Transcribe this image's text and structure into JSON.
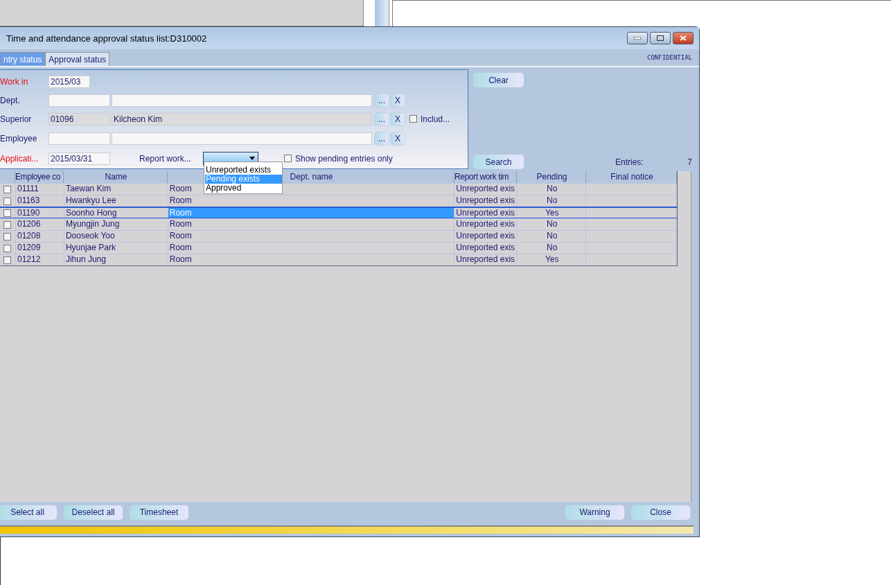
{
  "window": {
    "title": "Time and attendance approval status list:D310002",
    "badge": "CONFIDENTIAL"
  },
  "tabs": [
    {
      "label": "ntry status",
      "selected": true
    },
    {
      "label": "Approval status",
      "selected": false
    }
  ],
  "filters": {
    "work_in": {
      "label": "Work in",
      "value": "2015/03"
    },
    "dept": {
      "label": "Dept.",
      "browse_label": "...",
      "clear_label": "X"
    },
    "superior": {
      "label": "Superior",
      "code": "01096",
      "name": "Kilcheon Kim",
      "browse_label": "...",
      "clear_label": "X",
      "include_label": "Includ...",
      "include_checked": false
    },
    "employee": {
      "label": "Employee",
      "browse_label": "...",
      "clear_label": "X"
    },
    "application": {
      "label": "Applicati...",
      "value": "2015/03/31"
    },
    "report_label": "Report work...",
    "pending_only": {
      "label": "Show pending entries only",
      "checked": false
    }
  },
  "dropdown": {
    "options": [
      {
        "label": "Unreported exists",
        "selected": false
      },
      {
        "label": "Pending exists",
        "selected": true
      },
      {
        "label": "Approved",
        "selected": false
      }
    ]
  },
  "side_buttons": {
    "clear": "Clear",
    "search": "Search"
  },
  "entries": {
    "label": "Entries:",
    "count": "7"
  },
  "table": {
    "columns": [
      "Employee co",
      "Name",
      "Dept. name",
      "Report work tim",
      "Pending",
      "Final notice"
    ],
    "rows": [
      {
        "code": "01111",
        "name": "Taewan Kim",
        "dept": "Room",
        "report": "Unreported exis",
        "pending": "No",
        "checked": false,
        "selected": false
      },
      {
        "code": "01163",
        "name": "Hwankyu Lee",
        "dept": "Room",
        "report": "Unreported exis",
        "pending": "No",
        "checked": false,
        "selected": false
      },
      {
        "code": "01190",
        "name": "Soonho Hong",
        "dept": "Room",
        "report": "Unreported exis",
        "pending": "Yes",
        "checked": false,
        "selected": true
      },
      {
        "code": "01206",
        "name": "Myungjin Jung",
        "dept": "Room",
        "report": "Unreported exis",
        "pending": "No",
        "checked": false,
        "selected": false
      },
      {
        "code": "01208",
        "name": "Dooseok Yoo",
        "dept": "Room",
        "report": "Unreported exis",
        "pending": "No",
        "checked": false,
        "selected": false
      },
      {
        "code": "01209",
        "name": "Hyunjae Park",
        "dept": "Room",
        "report": "Unreported exis",
        "pending": "No",
        "checked": false,
        "selected": false
      },
      {
        "code": "01212",
        "name": "Jihun Jung",
        "dept": "Room",
        "report": "Unreported exis",
        "pending": "Yes",
        "checked": false,
        "selected": false
      }
    ]
  },
  "bottom_buttons": {
    "left": [
      "Select all",
      "Deselect all",
      "Timesheet"
    ],
    "right": [
      "Warning",
      "Close"
    ]
  }
}
